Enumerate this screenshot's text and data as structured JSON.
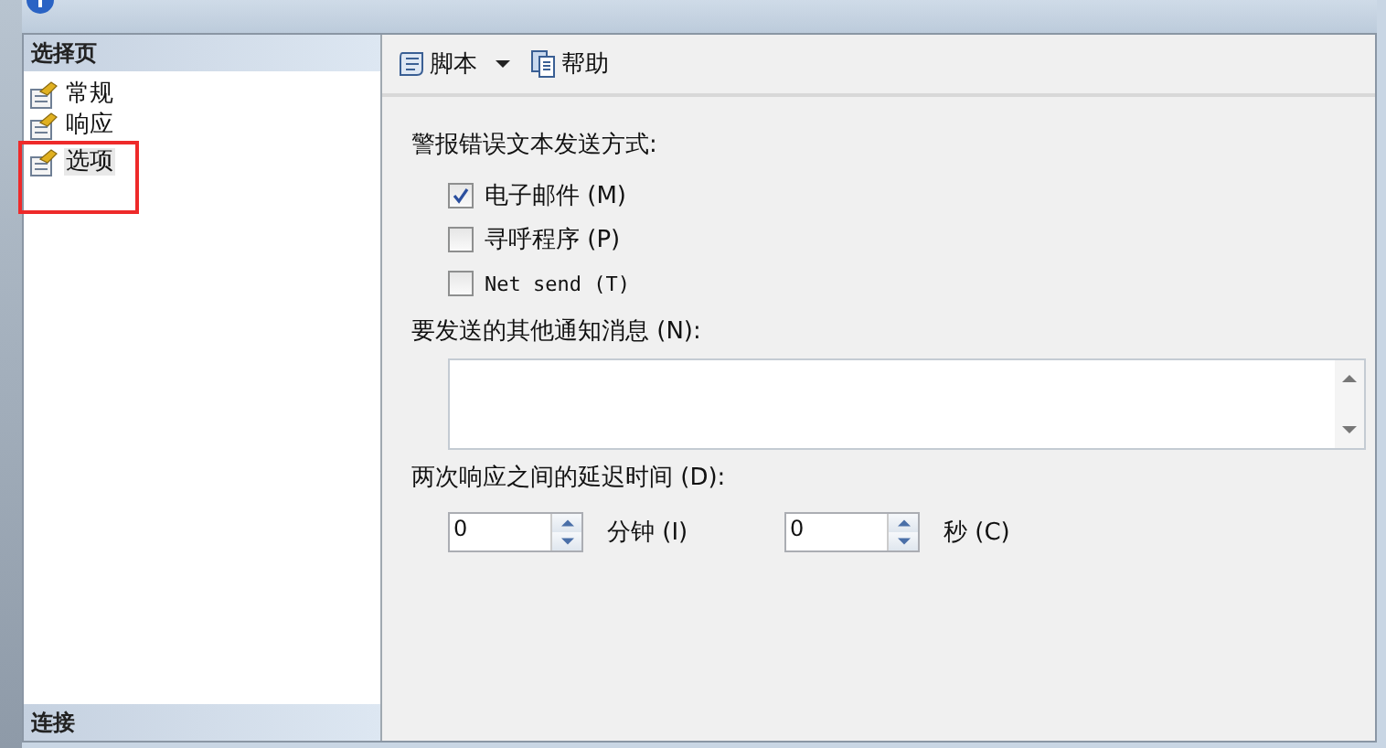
{
  "sidebar": {
    "header": "选择页",
    "items": [
      {
        "label": "常规",
        "selected": false,
        "highlighted": false
      },
      {
        "label": "响应",
        "selected": false,
        "highlighted": false
      },
      {
        "label": "选项",
        "selected": true,
        "highlighted": true
      }
    ],
    "footer": "连接"
  },
  "toolbar": [
    {
      "kind": "script",
      "label": "脚本",
      "dropdown": true
    },
    {
      "kind": "help",
      "label": "帮助",
      "dropdown": false
    }
  ],
  "options": {
    "send_label": "警报错误文本发送方式:",
    "methods": [
      {
        "label": "电子邮件 (M)",
        "checked": true
      },
      {
        "label": "寻呼程序 (P)",
        "checked": false
      },
      {
        "label": "Net send (T)",
        "checked": false
      }
    ],
    "message_label": "要发送的其他通知消息 (N):",
    "delay_label": "两次响应之间的延迟时间 (D):",
    "delays": [
      {
        "value": "0",
        "unit": "分钟 (I)"
      },
      {
        "value": "0",
        "unit": "秒 (C)"
      }
    ]
  }
}
